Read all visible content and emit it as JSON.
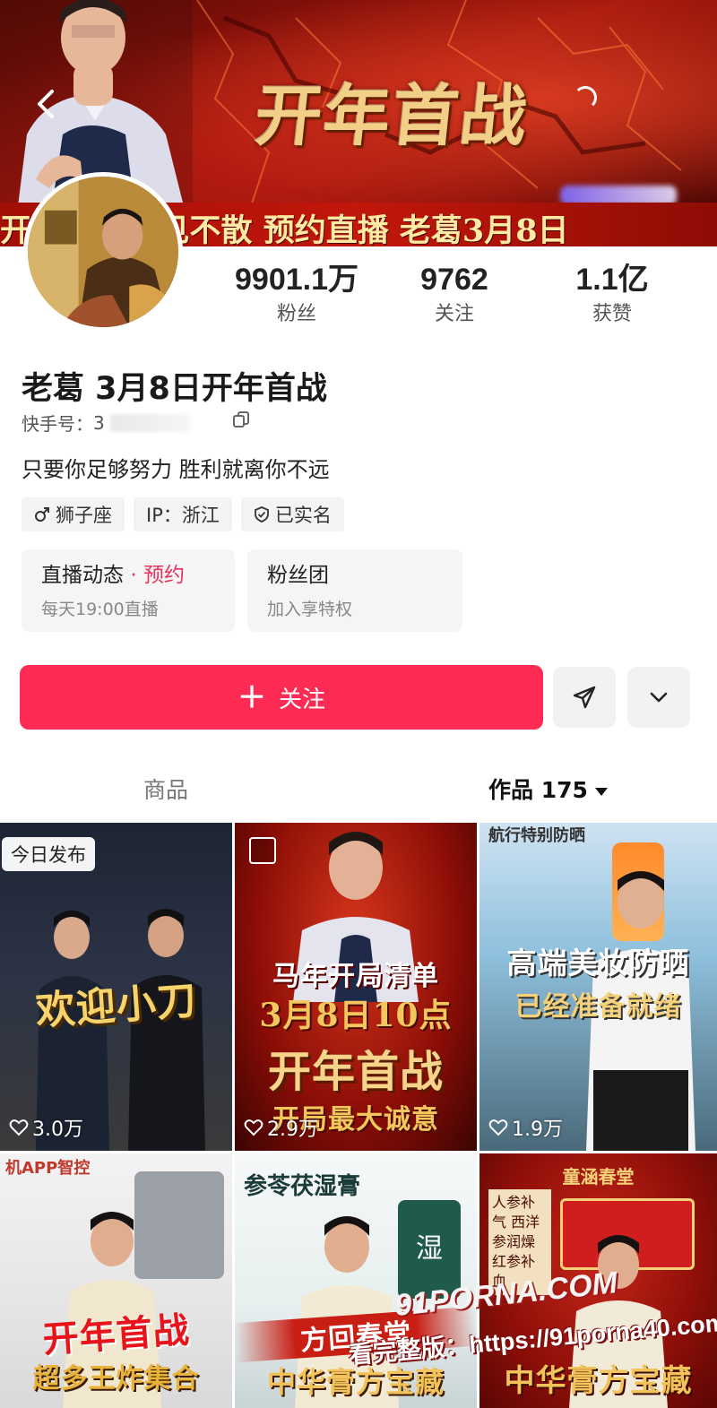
{
  "banner": {
    "title": "开年首战",
    "strip_text": "开 缘 老  不见不散    预约直播    老葛3月8日",
    "back_icon": "chevron-left-icon"
  },
  "stats": [
    {
      "value": "9901.1万",
      "label": "粉丝"
    },
    {
      "value": "9762",
      "label": "关注"
    },
    {
      "value": "1.1亿",
      "label": "获赞"
    }
  ],
  "profile": {
    "nickname": "老葛 3月8日开年首战",
    "kuaishou_id_label": "快手号：",
    "kuaishou_id_value": "3",
    "bio": "只要你足够努力 胜利就离你不远"
  },
  "tags": [
    {
      "icon": "male-icon",
      "label": "狮子座"
    },
    {
      "icon": "",
      "label": "IP：浙江"
    },
    {
      "icon": "verified-shield-icon",
      "label": "已实名"
    }
  ],
  "cards": {
    "live": {
      "title": "直播动态",
      "dot": "·",
      "accent": "预约",
      "sub": "每天19:00直播"
    },
    "fan_club": {
      "title": "粉丝团",
      "sub": "加入享特权"
    }
  },
  "actions": {
    "follow_plus": "＋",
    "follow_label": "关注",
    "share_icon": "send-icon",
    "more_icon": "chevron-down-icon"
  },
  "tabs": {
    "products": "商品",
    "works": "作品 175"
  },
  "grid": [
    {
      "badge": "今日发布",
      "overlay": "欢迎小刀",
      "likes": "3.0万"
    },
    {
      "badge": "",
      "overlay_1": "马年开局清单",
      "overlay_2": "3月8日10点",
      "overlay_3": "开年首战",
      "overlay_4": "开局最大诚意",
      "likes": "2.9万"
    },
    {
      "top_text": "航行特别防晒",
      "overlay_1": "高端美妆防晒",
      "overlay_2": "已经准备就绪",
      "likes": "1.9万"
    },
    {
      "top_text": "机APP智控",
      "overlay_1": "开年首战",
      "overlay_2": "超多王炸集合"
    },
    {
      "top_text": "参苓茯湿膏",
      "jar_text": "湿",
      "overlay_1": "方回春堂",
      "overlay_2": "中华膏方宝藏"
    },
    {
      "top_text": "童涵春堂",
      "side_text": "人参补气 西洋参润燥 红参补血",
      "overlay_1": "中华膏方宝藏"
    }
  ],
  "watermark": {
    "logo": "91PORNA.COM",
    "url": "看完整版：https://91porna40.com"
  },
  "colors": {
    "follow": "#fe2c55",
    "accent_pink": "#e8335c",
    "banner_red": "#a4160c",
    "gold": "#f2cf86"
  }
}
